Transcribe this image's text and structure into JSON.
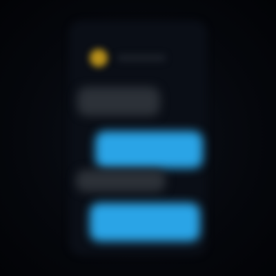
{
  "colors": {
    "background": "#05070c",
    "phone": "#0a0e16",
    "avatar": "#b8901a",
    "incoming_bubble": "#2c3138",
    "outgoing_bubble": "#2aa4e6"
  },
  "header": {
    "name": "",
    "avatar_icon": "avatar-icon"
  },
  "messages": [
    {
      "direction": "incoming",
      "text": ""
    },
    {
      "direction": "outgoing",
      "text": ""
    },
    {
      "direction": "incoming",
      "text": ""
    },
    {
      "direction": "outgoing",
      "text": ""
    }
  ]
}
